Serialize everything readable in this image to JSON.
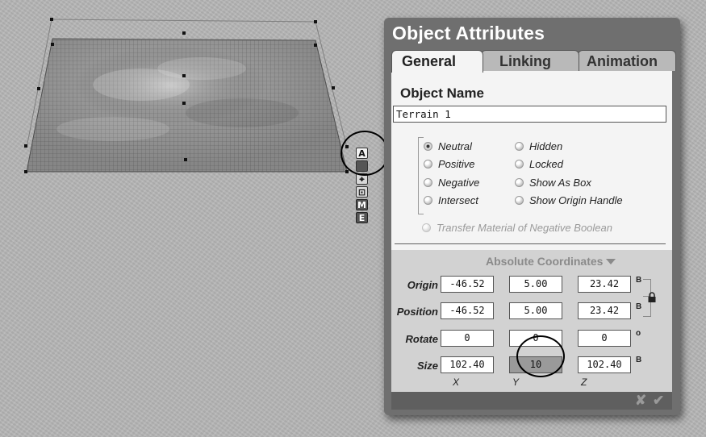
{
  "panel": {
    "title": "Object Attributes",
    "tabs": [
      {
        "label": "General",
        "active": true
      },
      {
        "label": "Linking",
        "active": false
      },
      {
        "label": "Animation",
        "active": false
      }
    ],
    "object_name": {
      "label": "Object Name",
      "value": "Terrain 1"
    },
    "options_left": [
      {
        "label": "Neutral",
        "selected": true
      },
      {
        "label": "Positive",
        "selected": false
      },
      {
        "label": "Negative",
        "selected": false
      },
      {
        "label": "Intersect",
        "selected": false
      }
    ],
    "options_right": [
      {
        "label": "Hidden",
        "selected": false
      },
      {
        "label": "Locked",
        "selected": false
      },
      {
        "label": "Show As Box",
        "selected": false
      },
      {
        "label": "Show Origin Handle",
        "selected": false
      }
    ],
    "transfer_option": "Transfer Material of Negative Boolean",
    "coords": {
      "title": "Absolute Coordinates",
      "rows": [
        {
          "label": "Origin",
          "x": "-46.52",
          "y": "5.00",
          "z": "23.42",
          "unit": "B"
        },
        {
          "label": "Position",
          "x": "-46.52",
          "y": "5.00",
          "z": "23.42",
          "unit": "B"
        },
        {
          "label": "Rotate",
          "x": "0",
          "y": "0",
          "z": "0",
          "unit": "o"
        },
        {
          "label": "Size",
          "x": "102.40",
          "y": "10",
          "z": "102.40",
          "unit": "B"
        }
      ],
      "axes": [
        "X",
        "Y",
        "Z"
      ]
    },
    "footer": {
      "cancel_icon": "x-icon",
      "ok_icon": "check-icon",
      "cancel": "✘",
      "ok": "✔"
    }
  },
  "toolbar": {
    "buttons": [
      {
        "label": "A",
        "icon": "attributes-icon"
      },
      {
        "label": "",
        "icon": "solid-block-icon"
      },
      {
        "label": "⌖",
        "icon": "link-icon"
      },
      {
        "label": "⊡",
        "icon": "camera-target-icon"
      },
      {
        "label": "M",
        "icon": "material-icon"
      },
      {
        "label": "E",
        "icon": "edit-icon"
      }
    ]
  },
  "colors": {
    "panel_bg": "#6f6f6f",
    "content_bg": "#f4f4f4",
    "highlight_field": "#9a9a9a"
  }
}
